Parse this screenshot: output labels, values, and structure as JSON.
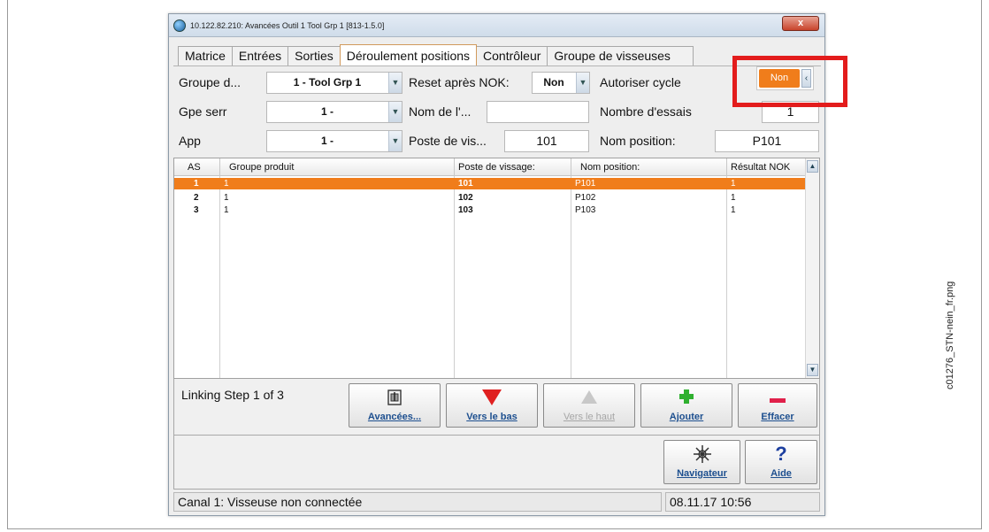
{
  "window": {
    "title": "10.122.82.210: Avancées  Outil 1  Tool Grp 1 [813-1.5.0]",
    "close_label": "x"
  },
  "tabs": [
    {
      "label": "Matrice"
    },
    {
      "label": "Entrées"
    },
    {
      "label": "Sorties"
    },
    {
      "label": "Déroulement positions"
    },
    {
      "label": "Contrôleur"
    },
    {
      "label": "Groupe de visseuses"
    }
  ],
  "form": {
    "groupe_label": "Groupe d...",
    "groupe_value": "1 - Tool Grp 1",
    "reset_label": "Reset après NOK:",
    "reset_value": "Non",
    "autoriser_label": "Autoriser cycle",
    "autoriser_value": "Non",
    "gpe_serr_label": "Gpe serr",
    "gpe_serr_value": "1 -",
    "nom_label": "Nom de l'...",
    "nom_value": "",
    "essais_label": "Nombre d'essais",
    "essais_value": "1",
    "app_label": "App",
    "app_value": "1 -",
    "poste_label": "Poste de vis...",
    "poste_value": "101",
    "nom_position_label": "Nom position:",
    "nom_position_value": "P101"
  },
  "table": {
    "columns": [
      "AS",
      "Groupe produit",
      "Poste de vissage:",
      "Nom position:",
      "Résultat NOK"
    ],
    "rows": [
      {
        "as": "1",
        "groupe": "1",
        "poste": "101",
        "nom": "P101",
        "resultat": "1",
        "selected": true
      },
      {
        "as": "2",
        "groupe": "1",
        "poste": "102",
        "nom": "P102",
        "resultat": "1",
        "selected": false
      },
      {
        "as": "3",
        "groupe": "1",
        "poste": "103",
        "nom": "P103",
        "resultat": "1",
        "selected": false
      }
    ]
  },
  "step": {
    "text": "Linking Step 1 of 3"
  },
  "buttons": {
    "avancees": "Avancées...",
    "vers_le_bas": "Vers le bas",
    "vers_le_haut": "Vers le haut",
    "ajouter": "Ajouter",
    "effacer": "Effacer",
    "navigateur": "Navigateur",
    "aide": "Aide"
  },
  "status": {
    "left": "Canal 1: Visseuse non connectée",
    "right": "08.11.17 10:56"
  },
  "caption": "c01276_STN-nein_fr.png",
  "colors": {
    "accent": "#f07d1b",
    "highlight": "#e31c1c",
    "link": "#1d4f8f"
  },
  "icons": {
    "app": "app-icon",
    "close": "close-icon",
    "combo_arrow": "chevron-down-icon",
    "toggle": "chevron-left-icon",
    "avancees": "settings-device-icon",
    "down": "arrow-down-icon",
    "up": "arrow-up-icon",
    "add": "plus-icon",
    "delete": "minus-icon",
    "navigator": "snowflake-navigator-icon",
    "help": "question-mark-icon"
  }
}
